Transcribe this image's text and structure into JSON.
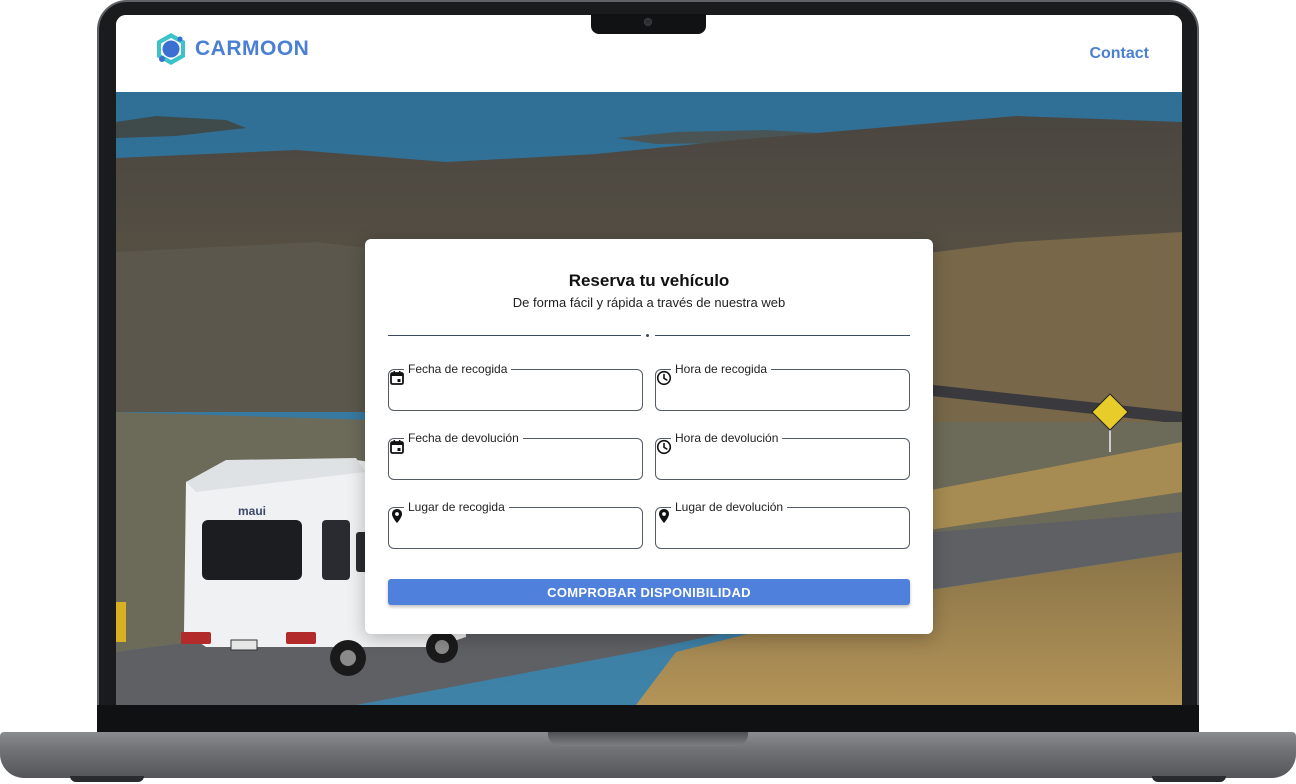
{
  "brand": {
    "name": "CARMOON",
    "color": "#4a7fd4",
    "accent": "#3cc3c9"
  },
  "nav": {
    "contact_label": "Contact"
  },
  "hero": {
    "vehicle_brand_text": "maui",
    "image_description": "campervan"
  },
  "booking": {
    "title": "Reserva tu vehículo",
    "subtitle": "De forma fácil y rápida a través de nuestra web",
    "fields": [
      {
        "label": "Fecha de recogida",
        "icon": "calendar-icon",
        "value": "",
        "placeholder": ""
      },
      {
        "label": "Hora de recogida",
        "icon": "clock-icon",
        "value": "",
        "placeholder": ""
      },
      {
        "label": "Fecha de devolución",
        "icon": "calendar-icon",
        "value": "",
        "placeholder": ""
      },
      {
        "label": "Hora de devolución",
        "icon": "clock-icon",
        "value": "",
        "placeholder": ""
      },
      {
        "label": "Lugar de recogida",
        "icon": "location-pin-icon",
        "value": "",
        "placeholder": ""
      },
      {
        "label": "Lugar de devolución",
        "icon": "location-pin-icon",
        "value": "",
        "placeholder": ""
      }
    ],
    "submit_label": "COMPROBAR DISPONIBILIDAD",
    "submit_color": "#4f80dc"
  }
}
